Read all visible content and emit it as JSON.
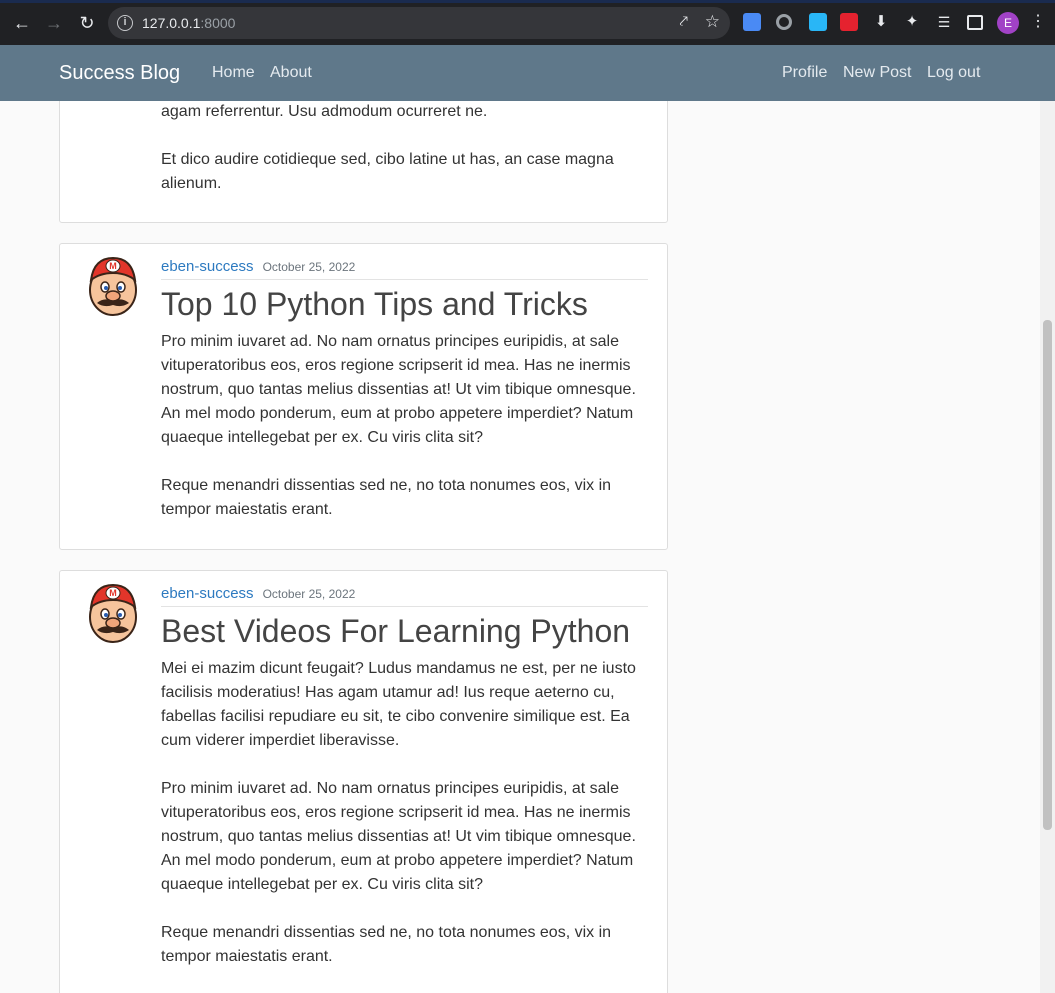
{
  "browser": {
    "url_host": "127.0.0.1",
    "url_port": ":8000",
    "profile_initial": "E"
  },
  "navbar": {
    "brand": "Success Blog",
    "left_links": [
      "Home",
      "About"
    ],
    "right_links": [
      "Profile",
      "New Post",
      "Log out"
    ]
  },
  "posts": [
    {
      "paragraphs": [
        "agam referrentur. Usu admodum ocurreret ne.",
        "Et dico audire cotidieque sed, cibo latine ut has, an case magna alienum."
      ]
    },
    {
      "author": "eben-success",
      "date": "October 25, 2022",
      "title": "Top 10 Python Tips and Tricks",
      "paragraphs": [
        "Pro minim iuvaret ad. No nam ornatus principes euripidis, at sale vituperatoribus eos, eros regione scripserit id mea. Has ne inermis nostrum, quo tantas melius dissentias at! Ut vim tibique omnesque. An mel modo ponderum, eum at probo appetere imperdiet? Natum quaeque intellegebat per ex. Cu viris clita sit?",
        "Reque menandri dissentias sed ne, no tota nonumes eos, vix in tempor maiestatis erant."
      ]
    },
    {
      "author": "eben-success",
      "date": "October 25, 2022",
      "title": "Best Videos For Learning Python",
      "paragraphs": [
        "Mei ei mazim dicunt feugait? Ludus mandamus ne est, per ne iusto facilisis moderatius! Has agam utamur ad! Ius reque aeterno cu, fabellas facilisi repudiare eu sit, te cibo convenire similique est. Ea cum viderer imperdiet liberavisse.",
        "Pro minim iuvaret ad. No nam ornatus principes euripidis, at sale vituperatoribus eos, eros regione scripserit id mea. Has ne inermis nostrum, quo tantas melius dissentias at! Ut vim tibique omnesque. An mel modo ponderum, eum at probo appetere imperdiet? Natum quaeque intellegebat per ex. Cu viris clita sit?",
        "Reque menandri dissentias sed ne, no tota nonumes eos, vix in tempor maiestatis erant."
      ]
    }
  ]
}
